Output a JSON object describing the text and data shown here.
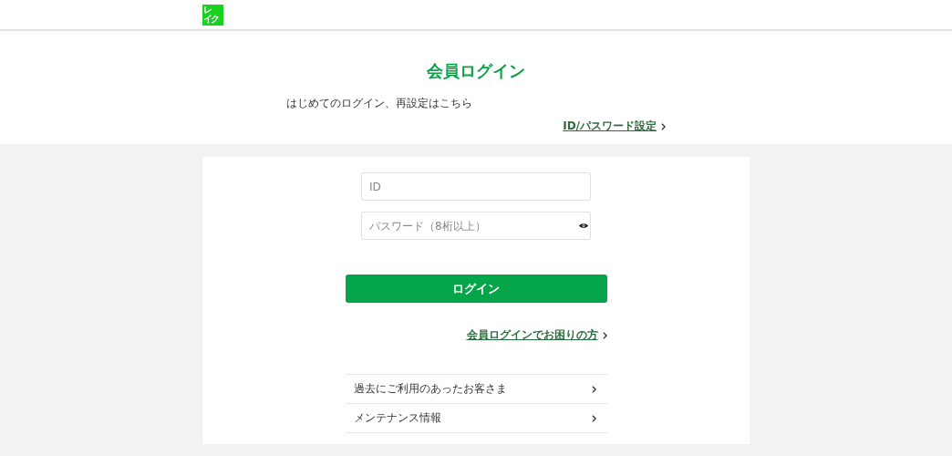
{
  "logo": {
    "lines": [
      "レ",
      "イク"
    ]
  },
  "title": "会員ログイン",
  "intro": "はじめてのログイン、再設定はこちら",
  "reset_link": "ID/パスワード設定",
  "fields": [
    {
      "kind": "text",
      "placeholder": "ID"
    },
    {
      "kind": "password",
      "placeholder": "パスワード（8桁以上）"
    }
  ],
  "login_button": "ログイン",
  "help_link": "会員ログインでお困りの方",
  "menu": [
    "過去にご利用のあったお客さま",
    "メンテナンス情報"
  ]
}
